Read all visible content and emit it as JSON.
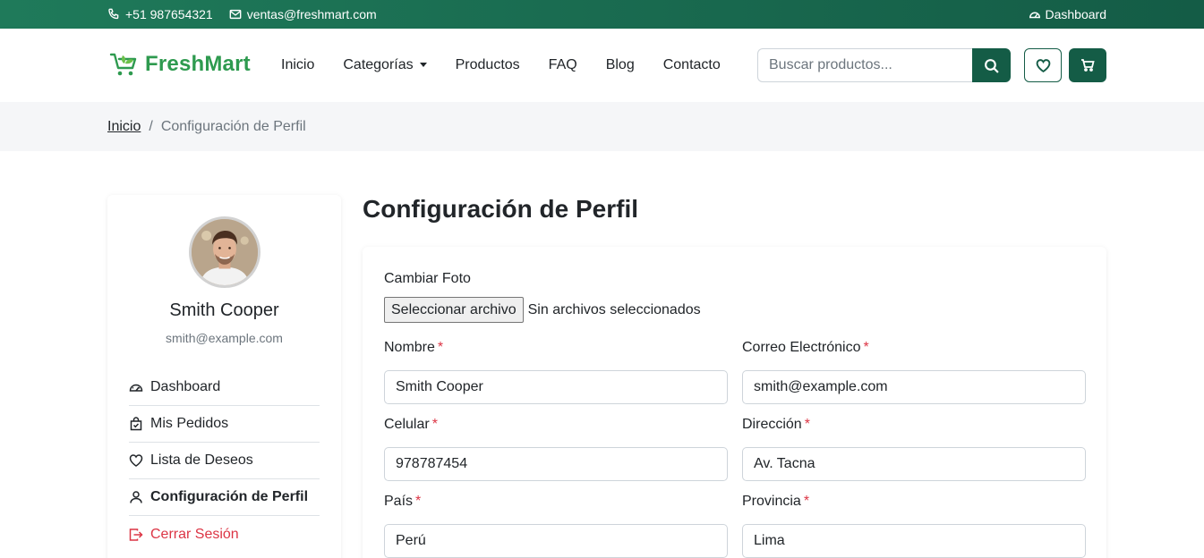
{
  "topbar": {
    "phone": "+51 987654321",
    "email": "ventas@freshmart.com",
    "dashboard": "Dashboard"
  },
  "brand": {
    "name": "FreshMart",
    "color": "#2e9a4f"
  },
  "nav": {
    "items": [
      "Inicio",
      "Categorías",
      "Productos",
      "FAQ",
      "Blog",
      "Contacto"
    ],
    "search_placeholder": "Buscar productos...",
    "accent": "#145c46"
  },
  "breadcrumb": {
    "home": "Inicio",
    "separator": "/",
    "current": "Configuración de Perfil"
  },
  "sidebar": {
    "user_name": "Smith Cooper",
    "user_email": "smith@example.com",
    "items": [
      {
        "label": "Dashboard",
        "icon": "gauge-icon"
      },
      {
        "label": "Mis Pedidos",
        "icon": "bag-check-icon"
      },
      {
        "label": "Lista de Deseos",
        "icon": "heart-icon"
      },
      {
        "label": "Configuración de Perfil",
        "icon": "person-icon"
      },
      {
        "label": "Cerrar Sesión",
        "icon": "logout-icon"
      }
    ]
  },
  "main": {
    "title": "Configuración de Perfil",
    "photo": {
      "label": "Cambiar Foto",
      "button": "Seleccionar archivo",
      "status": "Sin archivos seleccionados"
    },
    "required_mark": "*",
    "fields": {
      "nombre": {
        "label": "Nombre",
        "value": "Smith Cooper"
      },
      "correo": {
        "label": "Correo Electrónico",
        "value": "smith@example.com"
      },
      "celular": {
        "label": "Celular",
        "value": "978787454"
      },
      "direccion": {
        "label": "Dirección",
        "value": "Av. Tacna"
      },
      "pais": {
        "label": "País",
        "value": "Perú"
      },
      "provincia": {
        "label": "Provincia",
        "value": "Lima"
      }
    }
  }
}
